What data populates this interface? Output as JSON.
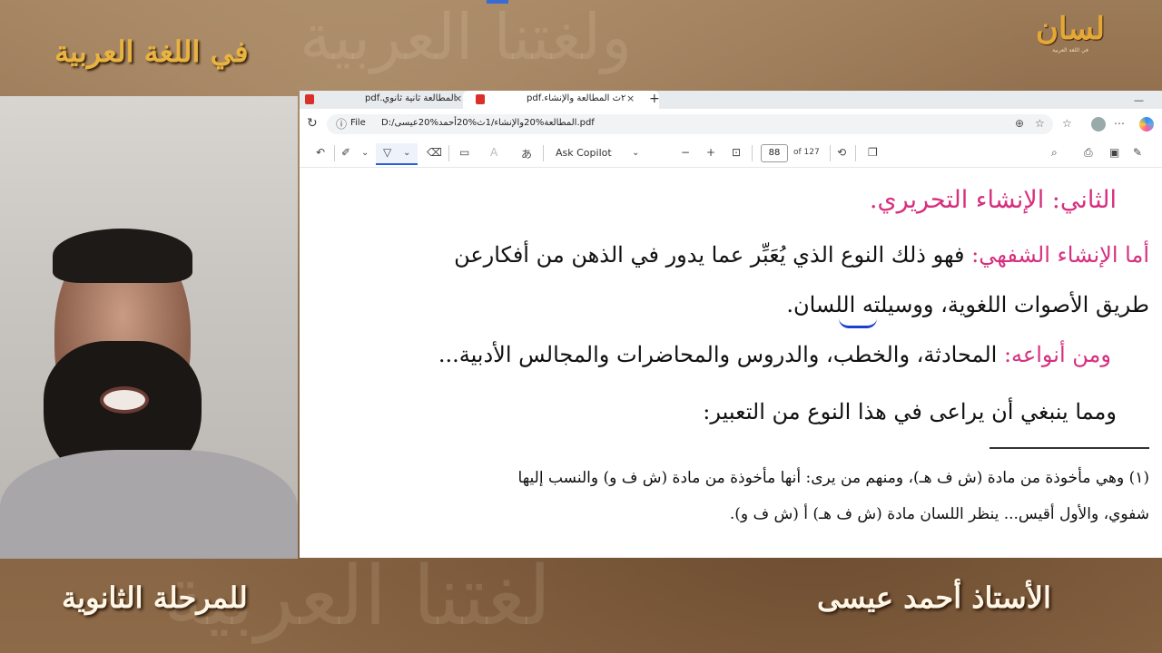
{
  "overlay": {
    "brand_title": "في اللغة العربية",
    "watermark_top": "ولغتنا العربية",
    "watermark_bottom": "لغتنا العربية",
    "logo_mark": "لسان",
    "logo_sub": "في اللغة العربية",
    "caption_left": "للمرحلة الثانوية",
    "caption_right": "الأستاذ أحمد عيسى"
  },
  "browser": {
    "tabs": [
      {
        "label": "المطالعة ثانية ثانوي.pdf"
      },
      {
        "label": "٢ث المطالعة والإنشاء.pdf"
      }
    ],
    "address": {
      "file_label": "File",
      "url": "D:/المطالعة%20والإنشاء/1ث%20أحمد%20عيسى.pdf"
    },
    "toolbar": {
      "ask_copilot": "Ask Copilot",
      "page_number": "88",
      "page_of": "of 127"
    }
  },
  "document": {
    "heading": "الثاني: الإنشاء التحريري.",
    "oral_label": "أما الإنشاء الشفهي:",
    "oral_text": "فهو ذلك النوع الذي يُعَبِّر عما يدور في الذهن من أفكارعن",
    "oral_text_2": "طريق الأصوات اللغوية، ووسيلته اللسان.",
    "types_label": "ومن أنواعه:",
    "types_text": "المحادثة، والخطب، والدروس والمحاضرات والمجالس الأدبية...",
    "should_text": "ومما ينبغي أن يراعى في هذا النوع من التعبير:",
    "footnote_1": "(١) وهي مأخوذة من مادة (ش ف هـ)، ومنهم من يرى: أنها مأخوذة من مادة (ش ف و) والنسب إليها",
    "footnote_2": "شفوي، والأول أقيس... ينظر اللسان مادة (ش ف هـ) أ (ش ف و)."
  }
}
